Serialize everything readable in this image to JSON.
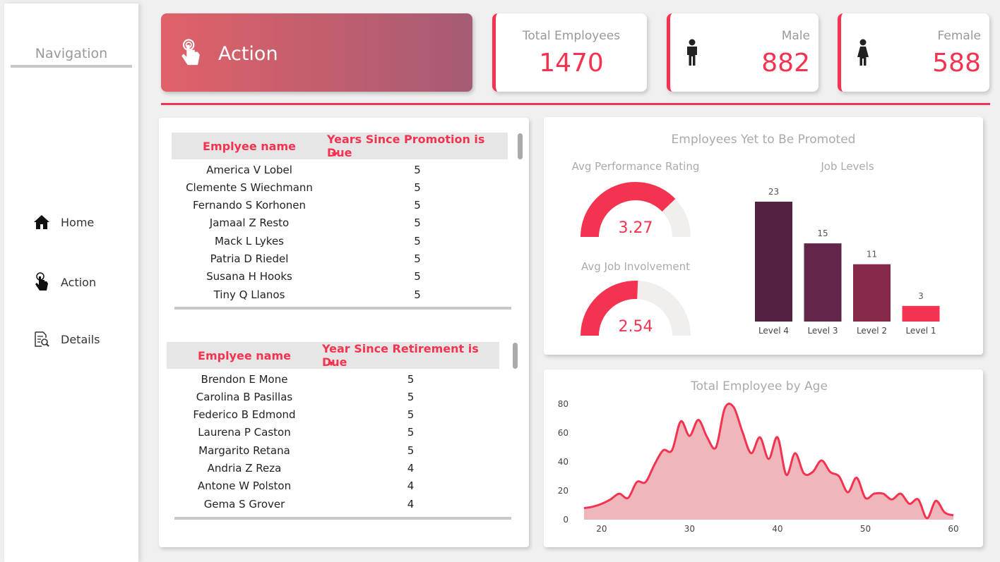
{
  "sidebar": {
    "title": "Navigation",
    "items": [
      {
        "label": "Home",
        "icon": "home-icon"
      },
      {
        "label": "Action",
        "icon": "pointer-hand-icon"
      },
      {
        "label": "Details",
        "icon": "document-search-icon"
      }
    ]
  },
  "banner": {
    "title": "Action",
    "icon": "pointer-hand-icon"
  },
  "kpis": {
    "total": {
      "label": "Total Employees",
      "value": "1470"
    },
    "male": {
      "label": "Male",
      "value": "882",
      "icon": "male-icon"
    },
    "female": {
      "label": "Female",
      "value": "588",
      "icon": "female-icon"
    }
  },
  "colors": {
    "accent": "#f43350",
    "banner_start": "#e06168",
    "banner_end": "#a55c74",
    "bar_colors": [
      "#522240",
      "#62264a",
      "#86294a",
      "#f43350"
    ]
  },
  "promotion_table": {
    "headers": [
      "Emplyee name",
      "Years Since Promotion is Due"
    ],
    "rows": [
      [
        "America V Lobel",
        "5"
      ],
      [
        "Clemente S Wiechmann",
        "5"
      ],
      [
        "Fernando S Korhonen",
        "5"
      ],
      [
        "Jamaal Z Resto",
        "5"
      ],
      [
        "Mack L Lykes",
        "5"
      ],
      [
        "Patria D Riedel",
        "5"
      ],
      [
        "Susana H Hooks",
        "5"
      ],
      [
        "Tiny Q Llanos",
        "5"
      ]
    ]
  },
  "retirement_table": {
    "headers": [
      "Emplyee name",
      "Year Since Retirement is Due"
    ],
    "rows": [
      [
        "Brendon E Mone",
        "5"
      ],
      [
        "Carolina B Pasillas",
        "5"
      ],
      [
        "Federico B Edmond",
        "5"
      ],
      [
        "Laurena P Caston",
        "5"
      ],
      [
        "Margarito Retana",
        "5"
      ],
      [
        "Andria Z Reza",
        "4"
      ],
      [
        "Antone W Polston",
        "4"
      ],
      [
        "Gema S Grover",
        "4"
      ]
    ]
  },
  "promotion_panel": {
    "title": "Employees Yet to Be Promoted",
    "gauge_perf": {
      "title": "Avg Performance Rating",
      "value": 3.27,
      "label": "3.27",
      "min": 1,
      "max": 4
    },
    "gauge_inv": {
      "title": "Avg Job Involvement",
      "value": 2.54,
      "label": "2.54",
      "min": 1,
      "max": 4
    }
  },
  "chart_data": [
    {
      "type": "bar",
      "title": "Job Levels",
      "categories": [
        "Level 4",
        "Level 3",
        "Level 2",
        "Level 1"
      ],
      "values": [
        23,
        15,
        11,
        3
      ],
      "data_labels": [
        "23",
        "15",
        "11",
        "3"
      ]
    },
    {
      "type": "area",
      "title": "Total Employee by Age",
      "xlabel": "",
      "ylabel": "",
      "xlim": [
        18,
        60
      ],
      "ylim": [
        0,
        80
      ],
      "xticks": [
        20,
        30,
        40,
        50,
        60
      ],
      "yticks": [
        0,
        20,
        40,
        60,
        80
      ],
      "x": [
        18,
        19,
        20,
        21,
        22,
        23,
        24,
        25,
        26,
        27,
        28,
        29,
        30,
        31,
        32,
        33,
        34,
        35,
        36,
        37,
        38,
        39,
        40,
        41,
        42,
        43,
        44,
        45,
        46,
        47,
        48,
        49,
        50,
        51,
        52,
        53,
        54,
        55,
        56,
        57,
        58,
        59,
        60
      ],
      "y": [
        8,
        9,
        11,
        14,
        18,
        15,
        26,
        26,
        38,
        48,
        48,
        68,
        58,
        69,
        57,
        50,
        77,
        78,
        61,
        46,
        57,
        42,
        57,
        31,
        46,
        32,
        33,
        41,
        33,
        30,
        19,
        29,
        15,
        18,
        18,
        14,
        18,
        11,
        14,
        1,
        13,
        5,
        3
      ]
    }
  ]
}
